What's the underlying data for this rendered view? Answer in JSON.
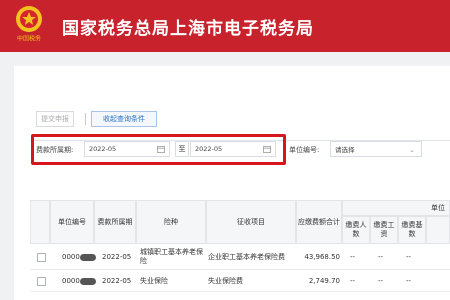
{
  "header": {
    "title": "国家税务总局上海市电子税务局",
    "emblem_text": "中国税务"
  },
  "tabs": {
    "submit": "提交申报",
    "conditions": "收起查询条件"
  },
  "filter": {
    "period_label": "费款所属期:",
    "period_start": "2022-05",
    "to_label": "至",
    "period_end": "2022-05",
    "unit_label": "单位编号:",
    "unit_placeholder": "请选择"
  },
  "table": {
    "group_header": "单位",
    "columns": [
      "单位编号",
      "费款所属期",
      "险种",
      "征收项目",
      "应缴费额合计",
      "缴费人数",
      "缴费工资",
      "缴费基数"
    ],
    "rows": [
      {
        "unit": "0000",
        "period": "2022-05",
        "type": "城镇职工基本养老保险",
        "item": "企业职工基本养老保险费",
        "amount": "43,968.50",
        "c1": "--",
        "c2": "--",
        "c3": "--"
      },
      {
        "unit": "0000",
        "period": "2022-05",
        "type": "失业保险",
        "item": "失业保险费",
        "amount": "2,749.70",
        "c1": "--",
        "c2": "--",
        "c3": "--"
      }
    ]
  },
  "colors": {
    "header_bg": "#c8222c",
    "highlight": "#d7151d",
    "link": "#2a6fbf"
  }
}
